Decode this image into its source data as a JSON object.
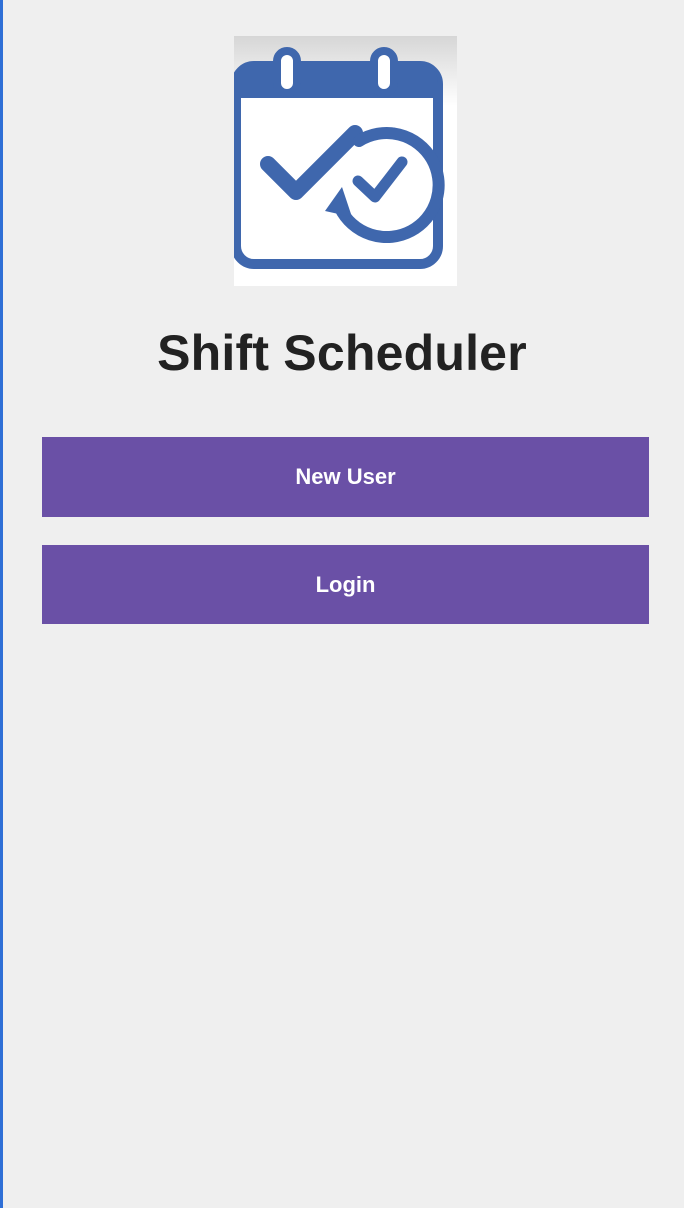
{
  "app": {
    "title": "Shift Scheduler",
    "logo_icon": "calendar-check-icon"
  },
  "actions": {
    "new_user_label": "New User",
    "login_label": "Login"
  },
  "colors": {
    "background": "#efefef",
    "button": "#6a50a6",
    "button_text": "#ffffff",
    "logo_blue": "#3f67ad",
    "title_text": "#222222"
  }
}
